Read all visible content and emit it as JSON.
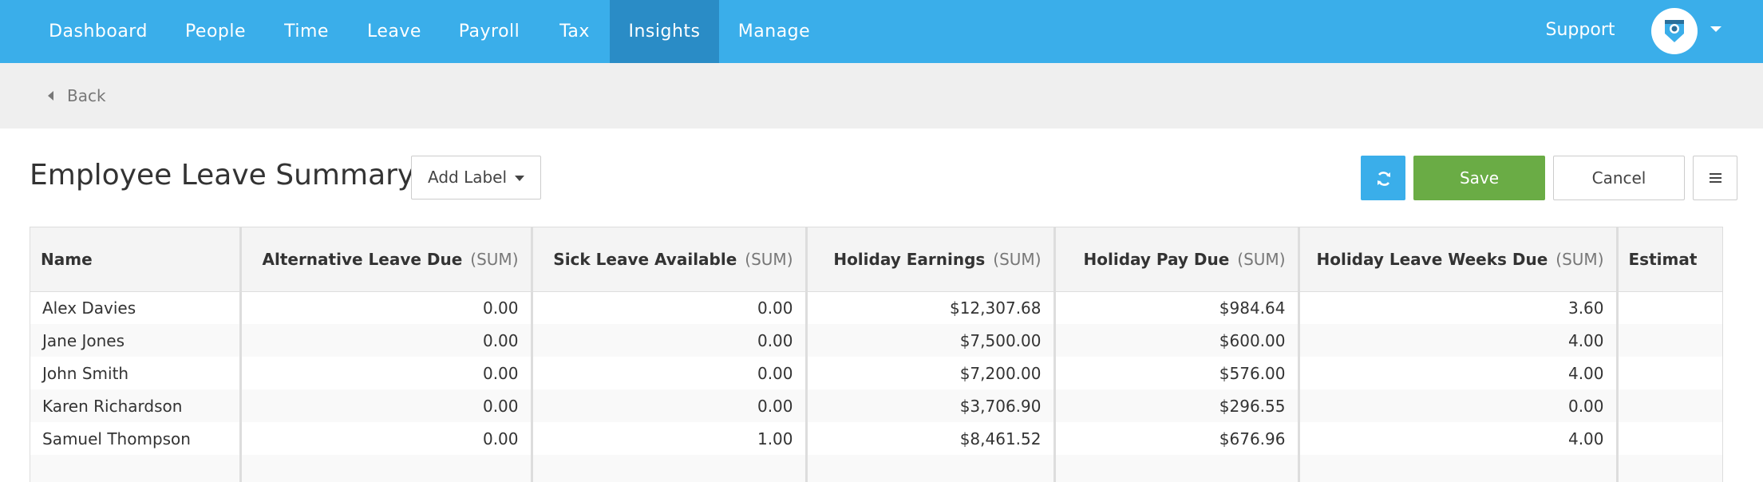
{
  "nav": {
    "items": [
      {
        "label": "Dashboard",
        "active": false
      },
      {
        "label": "People",
        "active": false
      },
      {
        "label": "Time",
        "active": false
      },
      {
        "label": "Leave",
        "active": false
      },
      {
        "label": "Payroll",
        "active": false
      },
      {
        "label": "Tax",
        "active": false
      },
      {
        "label": "Insights",
        "active": true
      },
      {
        "label": "Manage",
        "active": false
      }
    ],
    "support_label": "Support",
    "avatar_icon": "user-avatar-icon",
    "menu_icon": "chevron-down-icon"
  },
  "backbar": {
    "back_label": "Back"
  },
  "page": {
    "title": "Employee Leave Summary",
    "add_label": "Add Label"
  },
  "toolbar": {
    "refresh_icon": "refresh-icon",
    "save_label": "Save",
    "cancel_label": "Cancel",
    "menu_icon": "hamburger-icon"
  },
  "colors": {
    "nav_bg": "#3aaeea",
    "nav_active": "#2a8cc6",
    "save": "#6aac45",
    "refresh": "#3aaeea"
  },
  "table": {
    "columns": [
      {
        "label": "Name",
        "agg": ""
      },
      {
        "label": "Alternative Leave Due",
        "agg": "(SUM)"
      },
      {
        "label": "Sick Leave Available",
        "agg": "(SUM)"
      },
      {
        "label": "Holiday Earnings",
        "agg": "(SUM)"
      },
      {
        "label": "Holiday Pay Due",
        "agg": "(SUM)"
      },
      {
        "label": "Holiday Leave Weeks Due",
        "agg": "(SUM)"
      },
      {
        "label": "Estimat",
        "agg": ""
      }
    ],
    "rows": [
      {
        "name": "Alex Davies",
        "alt": "0.00",
        "sick": "0.00",
        "earn": "$12,307.68",
        "pay": "$984.64",
        "weeks": "3.60",
        "est": ""
      },
      {
        "name": "Jane Jones",
        "alt": "0.00",
        "sick": "0.00",
        "earn": "$7,500.00",
        "pay": "$600.00",
        "weeks": "4.00",
        "est": ""
      },
      {
        "name": "John Smith",
        "alt": "0.00",
        "sick": "0.00",
        "earn": "$7,200.00",
        "pay": "$576.00",
        "weeks": "4.00",
        "est": ""
      },
      {
        "name": "Karen Richardson",
        "alt": "0.00",
        "sick": "0.00",
        "earn": "$3,706.90",
        "pay": "$296.55",
        "weeks": "0.00",
        "est": ""
      },
      {
        "name": "Samuel Thompson",
        "alt": "0.00",
        "sick": "1.00",
        "earn": "$8,461.52",
        "pay": "$676.96",
        "weeks": "4.00",
        "est": ""
      }
    ]
  }
}
